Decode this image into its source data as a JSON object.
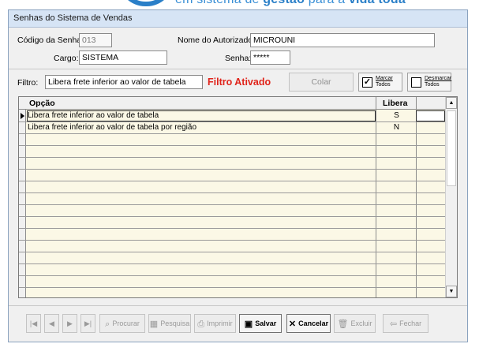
{
  "banner": {
    "tagline_prefix": "em sistema de ",
    "tagline_bold1": "gestão",
    "tagline_mid": " para a ",
    "tagline_bold2": "vida toda"
  },
  "window": {
    "title": "Senhas do Sistema de Vendas"
  },
  "form": {
    "codigo_label": "Código da Senha:",
    "codigo_value": "013",
    "autorizado_label": "Nome do Autorizado:",
    "autorizado_value": "MICROUNI",
    "cargo_label": "Cargo:",
    "cargo_value": "SISTEMA",
    "senha_label": "Senha:",
    "senha_value": "*****"
  },
  "filter": {
    "label": "Filtro:",
    "value": "Libera frete inferior ao valor de tabela",
    "status": "Filtro Ativado",
    "colar_label": "Colar",
    "marcar_line1": "Marcar",
    "marcar_line2": "Todos",
    "desmarcar_line1": "Desmarcar",
    "desmarcar_line2": "Todos"
  },
  "grid": {
    "headers": {
      "opcao": "Opção",
      "libera": "Libera"
    },
    "rows": [
      {
        "opcao": "Libera frete inferior ao valor de tabela",
        "libera": "S"
      },
      {
        "opcao": "Libera frete inferior ao valor de tabela por região",
        "libera": "N"
      }
    ]
  },
  "toolbar": {
    "procurar": "Procurar",
    "pesquisa": "Pesquisa",
    "imprimir": "Imprimir",
    "salvar": "Salvar",
    "cancelar": "Cancelar",
    "excluir": "Excluir",
    "fechar": "Fechar"
  }
}
